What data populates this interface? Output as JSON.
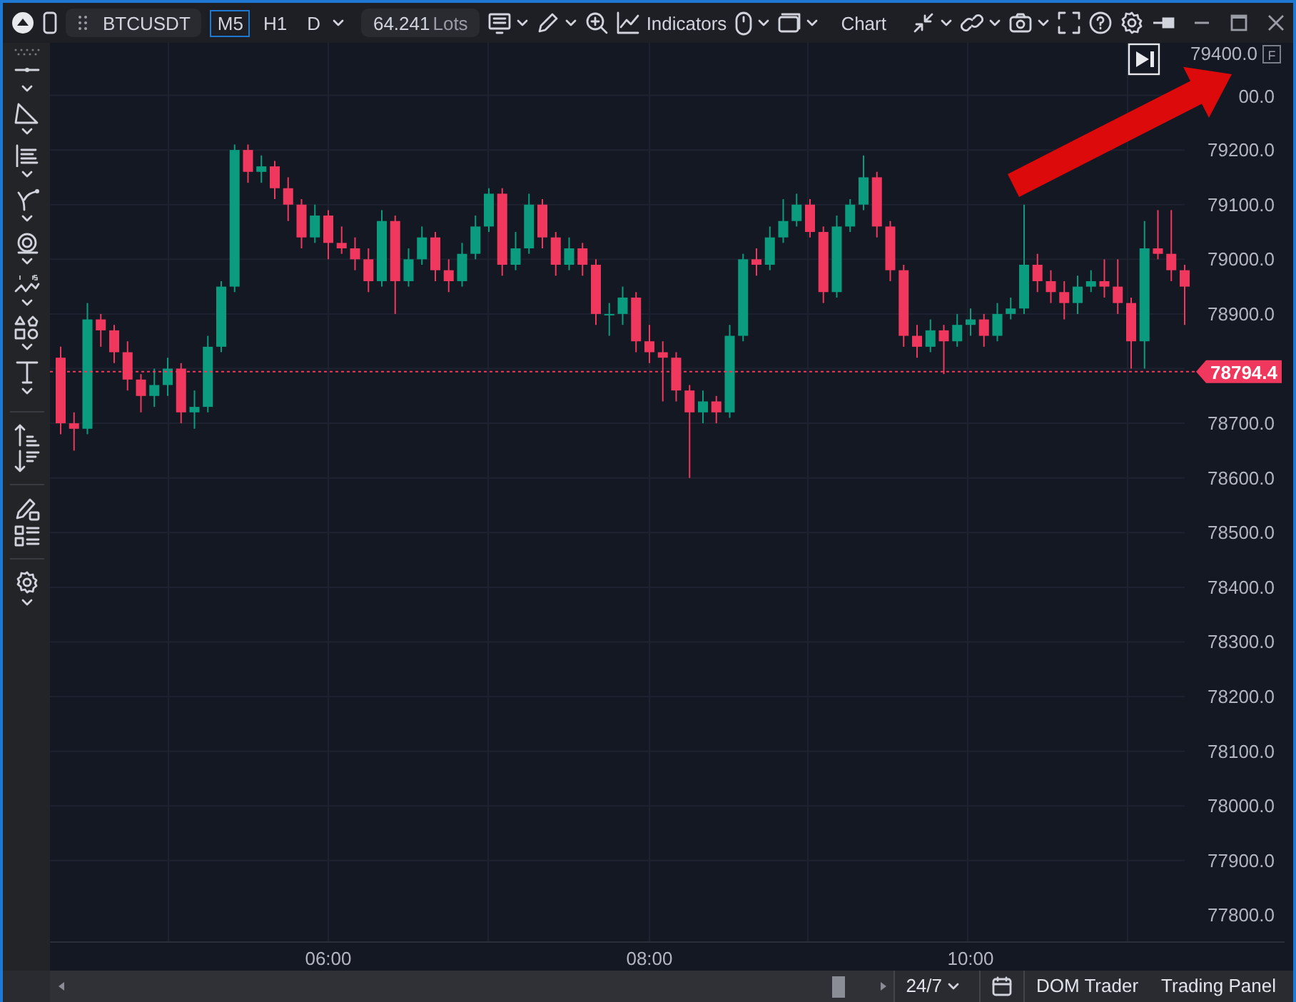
{
  "toolbar": {
    "symbol": "BTCUSDT",
    "timeframes": [
      {
        "label": "M5",
        "selected": true
      },
      {
        "label": "H1",
        "selected": false
      },
      {
        "label": "D",
        "selected": false
      }
    ],
    "lots": "64.241",
    "lots_unit": "Lots",
    "indicators": "Indicators",
    "chart": "Chart"
  },
  "chart": {
    "top_price_label": "79400.0",
    "covered_price_label": "00.0",
    "scale_mode": "F",
    "chart_data": {
      "type": "candlestick",
      "ylim": [
        77751,
        79396
      ],
      "grid": true,
      "ref_lines": [
        {
          "axis": "y",
          "value": 78794.4,
          "label": "78794.4",
          "color": "#f0385e"
        }
      ],
      "yticks": [
        {
          "value": 79200,
          "label": "79200.0"
        },
        {
          "value": 79100,
          "label": "79100.0"
        },
        {
          "value": 79000,
          "label": "79000.0"
        },
        {
          "value": 78900,
          "label": "78900.0"
        },
        {
          "value": 78700,
          "label": "78700.0"
        },
        {
          "value": 78600,
          "label": "78600.0"
        },
        {
          "value": 78500,
          "label": "78500.0"
        },
        {
          "value": 78400,
          "label": "78400.0"
        },
        {
          "value": 78300,
          "label": "78300.0"
        },
        {
          "value": 78200,
          "label": "78200.0"
        },
        {
          "value": 78100,
          "label": "78100.0"
        },
        {
          "value": 78000,
          "label": "78000.0"
        },
        {
          "value": 77900,
          "label": "77900.0"
        },
        {
          "value": 77800,
          "label": "77800.0"
        }
      ],
      "categories": [
        null,
        null,
        null,
        null,
        null,
        null,
        null,
        null,
        null,
        null,
        null,
        null,
        null,
        null,
        null,
        null,
        null,
        null,
        null,
        null,
        "06:00",
        null,
        null,
        null,
        null,
        null,
        null,
        null,
        null,
        null,
        null,
        null,
        null,
        null,
        null,
        null,
        null,
        null,
        null,
        null,
        null,
        null,
        null,
        null,
        "08:00",
        null,
        null,
        null,
        null,
        null,
        null,
        null,
        null,
        null,
        null,
        null,
        null,
        null,
        null,
        null,
        null,
        null,
        null,
        null,
        null,
        null,
        null,
        null,
        "10:00",
        null,
        null,
        null,
        null,
        null,
        null,
        null,
        null,
        null,
        null,
        null,
        null,
        null,
        null,
        null,
        null
      ],
      "ohlc": [
        [
          78820,
          78840,
          78680,
          78700
        ],
        [
          78700,
          78720,
          78650,
          78690
        ],
        [
          78690,
          78920,
          78680,
          78890
        ],
        [
          78890,
          78900,
          78840,
          78870
        ],
        [
          78870,
          78880,
          78810,
          78830
        ],
        [
          78830,
          78850,
          78760,
          78780
        ],
        [
          78780,
          78790,
          78720,
          78750
        ],
        [
          78750,
          78800,
          78730,
          78770
        ],
        [
          78770,
          78820,
          78750,
          78800
        ],
        [
          78800,
          78810,
          78700,
          78720
        ],
        [
          78720,
          78760,
          78690,
          78730
        ],
        [
          78730,
          78860,
          78720,
          78840
        ],
        [
          78840,
          78960,
          78830,
          78950
        ],
        [
          78950,
          79210,
          78940,
          79200
        ],
        [
          79200,
          79210,
          79140,
          79160
        ],
        [
          79160,
          79190,
          79140,
          79170
        ],
        [
          79170,
          79180,
          79110,
          79130
        ],
        [
          79130,
          79150,
          79070,
          79100
        ],
        [
          79100,
          79110,
          79020,
          79040
        ],
        [
          79040,
          79100,
          79030,
          79080
        ],
        [
          79080,
          79090,
          79000,
          79030
        ],
        [
          79030,
          79060,
          79010,
          79020
        ],
        [
          79020,
          79040,
          78980,
          79000
        ],
        [
          79000,
          79020,
          78940,
          78960
        ],
        [
          78960,
          79090,
          78950,
          79070
        ],
        [
          79070,
          79080,
          78900,
          78960
        ],
        [
          78960,
          79020,
          78950,
          79000
        ],
        [
          79000,
          79060,
          78990,
          79040
        ],
        [
          79040,
          79050,
          78960,
          78980
        ],
        [
          78980,
          79000,
          78940,
          78960
        ],
        [
          78960,
          79030,
          78950,
          79010
        ],
        [
          79010,
          79080,
          79000,
          79060
        ],
        [
          79060,
          79130,
          79050,
          79120
        ],
        [
          79120,
          79130,
          78970,
          78990
        ],
        [
          78990,
          79050,
          78980,
          79020
        ],
        [
          79020,
          79120,
          79010,
          79100
        ],
        [
          79100,
          79110,
          79020,
          79040
        ],
        [
          79040,
          79050,
          78970,
          78990
        ],
        [
          78990,
          79040,
          78980,
          79020
        ],
        [
          79020,
          79030,
          78970,
          78990
        ],
        [
          78990,
          79000,
          78880,
          78900
        ],
        [
          78900,
          78920,
          78860,
          78900
        ],
        [
          78900,
          78950,
          78880,
          78930
        ],
        [
          78930,
          78940,
          78830,
          78850
        ],
        [
          78850,
          78880,
          78810,
          78830
        ],
        [
          78830,
          78850,
          78740,
          78820
        ],
        [
          78820,
          78830,
          78740,
          78760
        ],
        [
          78760,
          78770,
          78600,
          78720
        ],
        [
          78720,
          78760,
          78700,
          78740
        ],
        [
          78740,
          78750,
          78700,
          78720
        ],
        [
          78720,
          78880,
          78710,
          78860
        ],
        [
          78860,
          79010,
          78850,
          79000
        ],
        [
          79000,
          79020,
          78970,
          78990
        ],
        [
          78990,
          79060,
          78980,
          79040
        ],
        [
          79040,
          79110,
          79030,
          79070
        ],
        [
          79070,
          79120,
          79060,
          79100
        ],
        [
          79100,
          79110,
          79040,
          79050
        ],
        [
          79050,
          79060,
          78920,
          78940
        ],
        [
          78940,
          79080,
          78930,
          79060
        ],
        [
          79060,
          79110,
          79050,
          79100
        ],
        [
          79100,
          79190,
          79090,
          79150
        ],
        [
          79150,
          79160,
          79040,
          79060
        ],
        [
          79060,
          79070,
          78960,
          78980
        ],
        [
          78980,
          78990,
          78840,
          78860
        ],
        [
          78860,
          78880,
          78820,
          78840
        ],
        [
          78840,
          78890,
          78830,
          78870
        ],
        [
          78870,
          78880,
          78790,
          78850
        ],
        [
          78850,
          78900,
          78840,
          78880
        ],
        [
          78880,
          78910,
          78860,
          78890
        ],
        [
          78890,
          78900,
          78840,
          78860
        ],
        [
          78860,
          78920,
          78850,
          78900
        ],
        [
          78900,
          78930,
          78890,
          78910
        ],
        [
          78910,
          79100,
          78900,
          78990
        ],
        [
          78990,
          79010,
          78940,
          78960
        ],
        [
          78960,
          78980,
          78920,
          78940
        ],
        [
          78940,
          78960,
          78890,
          78920
        ],
        [
          78920,
          78970,
          78900,
          78950
        ],
        [
          78950,
          78980,
          78940,
          78960
        ],
        [
          78960,
          79000,
          78930,
          78950
        ],
        [
          78950,
          79000,
          78900,
          78920
        ],
        [
          78920,
          78930,
          78800,
          78850
        ],
        [
          78850,
          79070,
          78800,
          79020
        ],
        [
          79020,
          79090,
          79000,
          79010
        ],
        [
          79010,
          79090,
          78960,
          78980
        ],
        [
          78980,
          78990,
          78880,
          78950
        ]
      ]
    }
  },
  "status_bar": {
    "session": "24/7",
    "buttons": [
      "DOM Trader",
      "Trading Panel"
    ]
  }
}
